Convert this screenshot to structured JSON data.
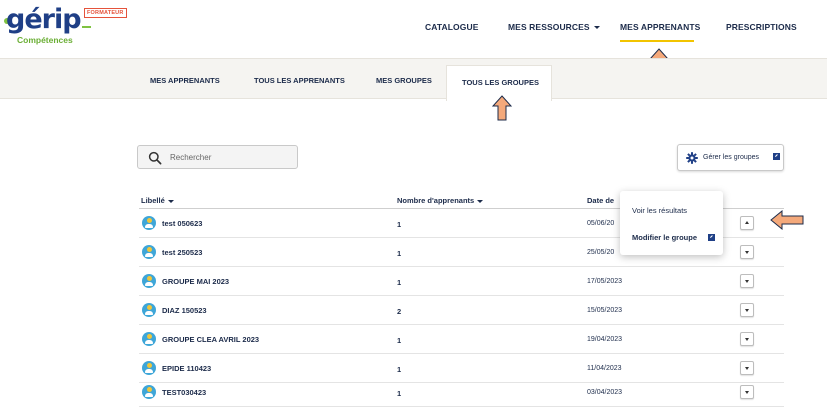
{
  "brand": {
    "name": "gérip",
    "badge": "FORMATEUR",
    "subtitle": "Compétences"
  },
  "main_nav": {
    "items": [
      {
        "label": "CATALOGUE"
      },
      {
        "label": "MES RESSOURCES"
      },
      {
        "label": "MES APPRENANTS"
      },
      {
        "label": "PRESCRIPTIONS"
      }
    ],
    "active_index": 2
  },
  "sub_nav": {
    "tabs": [
      {
        "label": "MES APPRENANTS"
      },
      {
        "label": "TOUS LES APPRENANTS"
      },
      {
        "label": "MES GROUPES"
      },
      {
        "label": "TOUS LES GROUPES"
      }
    ],
    "active_index": 3
  },
  "toolbar": {
    "search_placeholder": "Rechercher",
    "manage_label": "Gérer les groupes"
  },
  "table": {
    "columns": [
      {
        "label": "Libellé"
      },
      {
        "label": "Nombre d'apprenants"
      },
      {
        "label": "Date de"
      }
    ],
    "rows": [
      {
        "label": "test 050623",
        "count": "1",
        "date": "05/06/20",
        "expanded": true
      },
      {
        "label": "test 250523",
        "count": "1",
        "date": "25/05/20",
        "expanded": false
      },
      {
        "label": "GROUPE MAI 2023",
        "count": "1",
        "date": "17/05/2023",
        "expanded": false
      },
      {
        "label": "DIAZ 150523",
        "count": "2",
        "date": "15/05/2023",
        "expanded": false
      },
      {
        "label": "GROUPE CLEA AVRIL 2023",
        "count": "1",
        "date": "19/04/2023",
        "expanded": false
      },
      {
        "label": "EPIDE 110423",
        "count": "1",
        "date": "11/04/2023",
        "expanded": false
      },
      {
        "label": "TEST030423",
        "count": "1",
        "date": "03/04/2023",
        "expanded": false
      }
    ]
  },
  "row_menu": {
    "items": [
      {
        "label": "Voir les résultats"
      },
      {
        "label": "Modifier le groupe"
      }
    ]
  },
  "colors": {
    "brand_blue": "#1f3f86",
    "brand_green": "#7fc241",
    "accent_yellow": "#f2c400",
    "annotation_arrow": "#f4a97b",
    "avatar_blue": "#3ea6d8"
  }
}
